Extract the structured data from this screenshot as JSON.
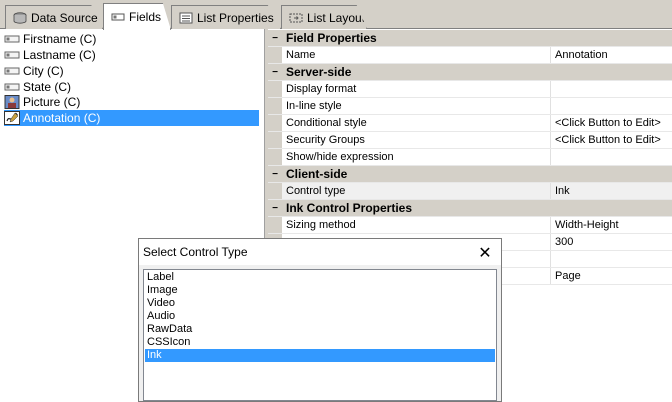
{
  "tabs": [
    {
      "label": "Data Source",
      "icon": "database-icon",
      "active": false
    },
    {
      "label": "Fields",
      "icon": "fields-icon",
      "active": true
    },
    {
      "label": "List Properties",
      "icon": "properties-icon",
      "active": false
    },
    {
      "label": "List Layout",
      "icon": "layout-icon",
      "active": false
    }
  ],
  "fields": [
    {
      "label": "Firstname (C)",
      "icon": "text-field-icon"
    },
    {
      "label": "Lastname (C)",
      "icon": "text-field-icon"
    },
    {
      "label": "City (C)",
      "icon": "text-field-icon"
    },
    {
      "label": "State (C)",
      "icon": "text-field-icon"
    },
    {
      "label": "Picture (C)",
      "icon": "picture-field-icon"
    },
    {
      "label": "Annotation (C)",
      "icon": "ink-field-icon",
      "selected": true
    }
  ],
  "grid": {
    "rows": [
      {
        "type": "cat",
        "name": "Field Properties",
        "toggle": "−"
      },
      {
        "type": "prop",
        "name": "Name",
        "value": "Annotation"
      },
      {
        "type": "cat",
        "name": "Server-side",
        "toggle": "−"
      },
      {
        "type": "prop",
        "name": "Display format",
        "value": ""
      },
      {
        "type": "prop",
        "name": "In-line style",
        "value": ""
      },
      {
        "type": "prop",
        "name": "Conditional style",
        "value": "<Click Button to Edit>"
      },
      {
        "type": "prop",
        "name": "Security Groups",
        "value": "<Click Button to Edit>"
      },
      {
        "type": "prop",
        "name": "Show/hide expression",
        "value": ""
      },
      {
        "type": "cat",
        "name": "Client-side",
        "toggle": "−"
      },
      {
        "type": "prop",
        "name": "Control type",
        "value": "Ink",
        "hilite": true
      },
      {
        "type": "cat",
        "name": "Ink Control Properties",
        "toggle": "−"
      },
      {
        "type": "prop",
        "name": "Sizing method",
        "value": "Width-Height"
      },
      {
        "type": "prop",
        "name": "",
        "value": "300"
      },
      {
        "type": "prop",
        "name": "",
        "value": ""
      },
      {
        "type": "prop",
        "name": "",
        "value": "Page"
      }
    ]
  },
  "dialog": {
    "title": "Select Control Type",
    "close": "✕",
    "options": [
      "Label",
      "Image",
      "Video",
      "Audio",
      "RawData",
      "CSSIcon",
      "Ink"
    ],
    "selected": "Ink"
  }
}
